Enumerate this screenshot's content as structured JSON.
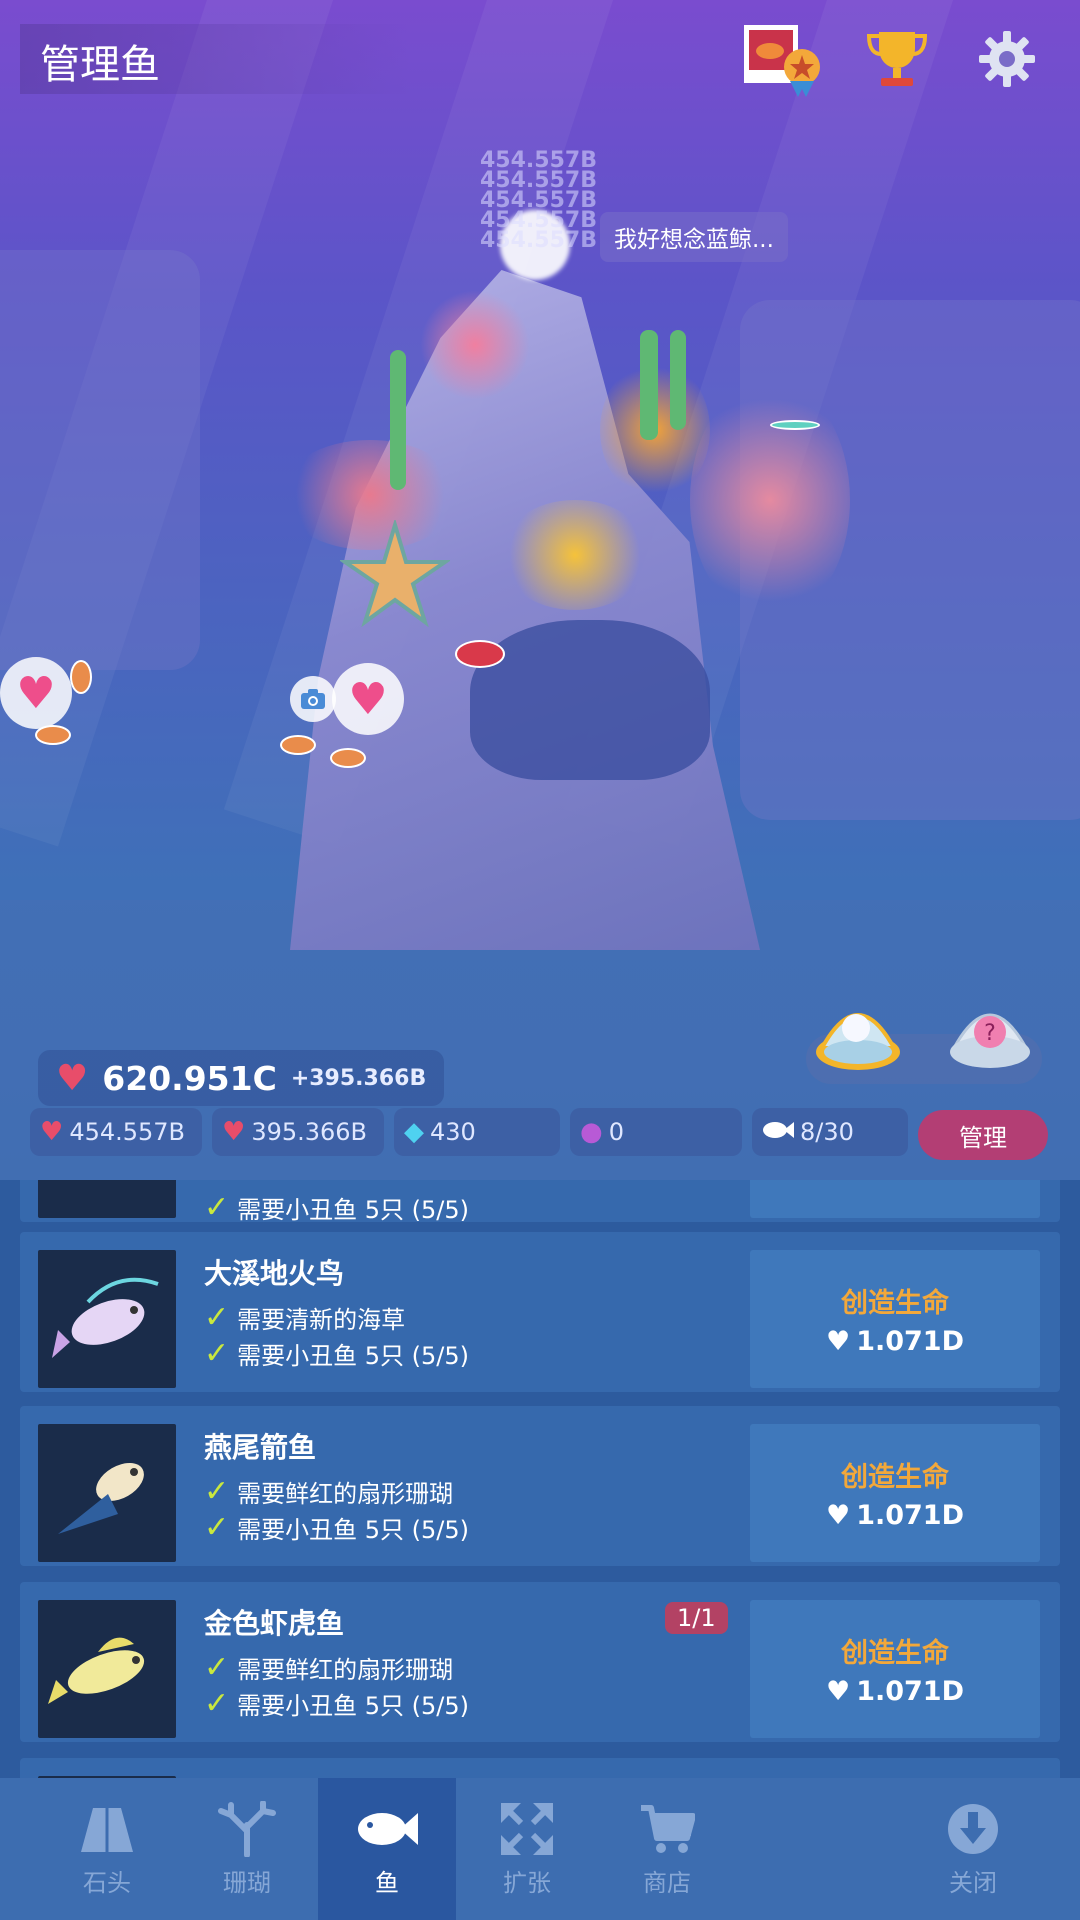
{
  "header": {
    "title": "管理鱼",
    "icons": [
      "fish-album-icon",
      "trophy-icon",
      "gear-icon"
    ]
  },
  "scene": {
    "floating_numbers": [
      "454.557B",
      "454.557B",
      "454.557B",
      "454.557B",
      "454.557B"
    ],
    "speech": "我好想念蓝鲸..."
  },
  "stats": {
    "hearts_total": "620.951C",
    "hearts_rate": "+395.366B",
    "tap_value": "454.557B",
    "time_value": "395.366B",
    "gems": "430",
    "pearls": "0",
    "fish_count": "8/30",
    "manage_label": "管理"
  },
  "colors": {
    "accent": "#b33e74",
    "create_label": "#f3a83a",
    "check": "#c9e83e",
    "badge": "#b34264"
  },
  "fish_list": {
    "partial_top_req": "需要小丑鱼 5只 (5/5)",
    "items": [
      {
        "name": "大溪地火鸟",
        "req1": "需要清新的海草",
        "req2": "需要小丑鱼 5只 (5/5)",
        "button_label": "创造生命",
        "cost": "1.071D"
      },
      {
        "name": "燕尾箭鱼",
        "req1": "需要鲜红的扇形珊瑚",
        "req2": "需要小丑鱼 5只 (5/5)",
        "button_label": "创造生命",
        "cost": "1.071D"
      },
      {
        "name": "金色虾虎鱼",
        "badge": "1/1",
        "req1": "需要鲜红的扇形珊瑚",
        "req2": "需要小丑鱼 5只 (5/5)",
        "button_label": "创造生命",
        "cost": "1.071D"
      }
    ]
  },
  "nav": {
    "items": [
      {
        "label": "石头",
        "icon": "rock-icon"
      },
      {
        "label": "珊瑚",
        "icon": "coral-icon"
      },
      {
        "label": "鱼",
        "icon": "fish-icon"
      },
      {
        "label": "扩张",
        "icon": "expand-icon"
      },
      {
        "label": "商店",
        "icon": "cart-icon"
      },
      {
        "label": "关闭",
        "icon": "download-icon"
      }
    ]
  }
}
